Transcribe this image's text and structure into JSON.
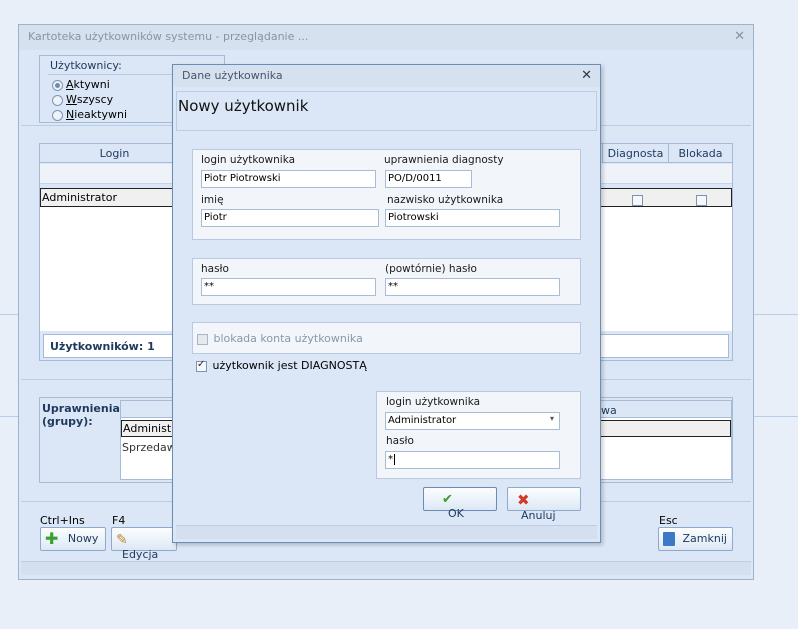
{
  "main": {
    "title": "Kartoteka użytkowników systemu - przeglądanie ...",
    "users_group": {
      "label": "Użytkownicy:",
      "options": [
        {
          "label": "Aktywni",
          "accel": "A",
          "selected": true
        },
        {
          "label": "Wszyscy",
          "accel": "W",
          "selected": false
        },
        {
          "label": "Nieaktywni",
          "accel": "N",
          "selected": false
        }
      ]
    },
    "table": {
      "columns": [
        "Login",
        "Diagnosta",
        "Blokada"
      ],
      "rows": [
        {
          "login": "Administrator",
          "diagnosta": false,
          "blokada": false
        }
      ],
      "count_label": "Użytkowników: 1"
    },
    "permissions": {
      "label": "Uprawnienia\n(grupy):",
      "label_line1": "Uprawnienia",
      "label_line2": "(grupy):",
      "column_partial": "wa",
      "items": [
        "Administrat",
        "Sprzedawc"
      ]
    },
    "toolbar": {
      "new_shortcut": "Ctrl+Ins",
      "new_label": "Nowy",
      "edit_shortcut": "F4",
      "edit_label": "Edycja",
      "close_shortcut": "Esc",
      "close_label": "Zamknij"
    }
  },
  "dialog": {
    "title": "Dane użytkownika",
    "heading": "Nowy użytkownik",
    "login_label": "login użytkownika",
    "login_value": "Piotr Piotrowski",
    "diag_label": "uprawnienia diagnosty",
    "diag_value": "PO/D/0011",
    "first_name_label": "imię",
    "first_name_value": "Piotr",
    "last_name_label": "nazwisko użytkownika",
    "last_name_value": "Piotrowski",
    "password_label": "hasło",
    "password_value": "**",
    "password2_label": "(powtórnie) hasło",
    "password2_value": "**",
    "lock_label": "blokada konta użytkownika",
    "lock_checked": false,
    "diagnosta_label": "użytkownik jest DIAGNOSTĄ",
    "diagnosta_checked": true,
    "auth_login_label": "login użytkownika",
    "auth_login_value": "Administrator",
    "auth_password_label": "hasło",
    "auth_password_value": "*",
    "ok_label": "OK",
    "cancel_label": "Anuluj"
  },
  "colors": {
    "accent": "#6e8bb3",
    "ok_icon": "#3a9a2a",
    "cancel_icon": "#d23a2a",
    "header_text": "#1e395b"
  }
}
